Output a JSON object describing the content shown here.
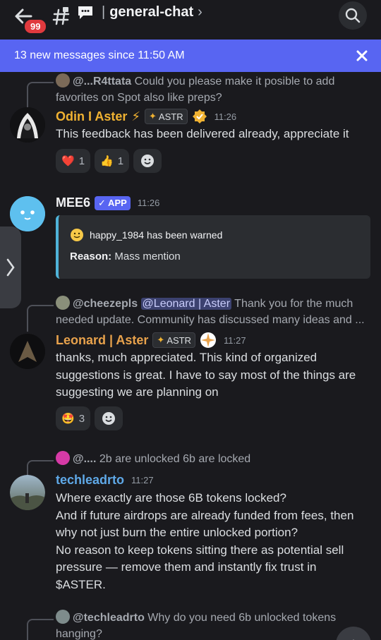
{
  "header": {
    "back_badge": "99",
    "channel_name": "general-chat",
    "separator": "|",
    "chevron": "›"
  },
  "banner": {
    "text": "13 new messages since 11:50 AM"
  },
  "messages": [
    {
      "reply": {
        "name": "@...R4ttata",
        "text": " Could you please make it posible to add favorites on Spot also like preps?"
      },
      "author": "Odin I Aster",
      "author_color": "#f0b232",
      "role": "ASTR",
      "time": "11:26",
      "text": "This feedback has been delivered already, appreciate it",
      "reactions": [
        {
          "emoji": "❤️",
          "count": "1"
        },
        {
          "emoji": "👍",
          "count": "1"
        }
      ]
    },
    {
      "author": "MEE6",
      "app_tag": "✓ APP",
      "time": "11:26",
      "embed": {
        "title": "happy_1984 has been warned",
        "reason_label": "Reason:",
        "reason": " Mass mention"
      }
    },
    {
      "reply": {
        "name": "@cheezepls",
        "mention": "@Leonard | Aster",
        "text": " Thank you for the much needed update. Community has discussed many ideas and ..."
      },
      "author": "Leonard | Aster",
      "author_color": "#e8a24c",
      "role": "ASTR",
      "time": "11:27",
      "text": "thanks, much appreciated. This kind of organized suggestions is great. I have to say most of the things are suggesting we are planning on",
      "reactions": [
        {
          "emoji": "🤩",
          "count": "3"
        }
      ]
    },
    {
      "reply": {
        "name": "@....",
        "text": "  2b are unlocked 6b are locked"
      },
      "author": "techleadrto",
      "author_color": "#5fa9e8",
      "time": "11:27",
      "lines": [
        "Where exactly are those 6B tokens locked?",
        "And if future airdrops are already funded from fees, then",
        "why not just burn the entire unlocked portion?",
        "No reason to keep tokens sitting there as potential sell",
        "pressure — remove them and instantly fix trust in",
        "$ASTER."
      ]
    },
    {
      "reply": {
        "name": "@techleadrto",
        "text": " Why do you need 6b unlocked tokens hanging?"
      }
    }
  ],
  "colors": {
    "accent": "#5865f2",
    "embed_bar": "#4fb3d9",
    "background": "#1a1a1e"
  }
}
